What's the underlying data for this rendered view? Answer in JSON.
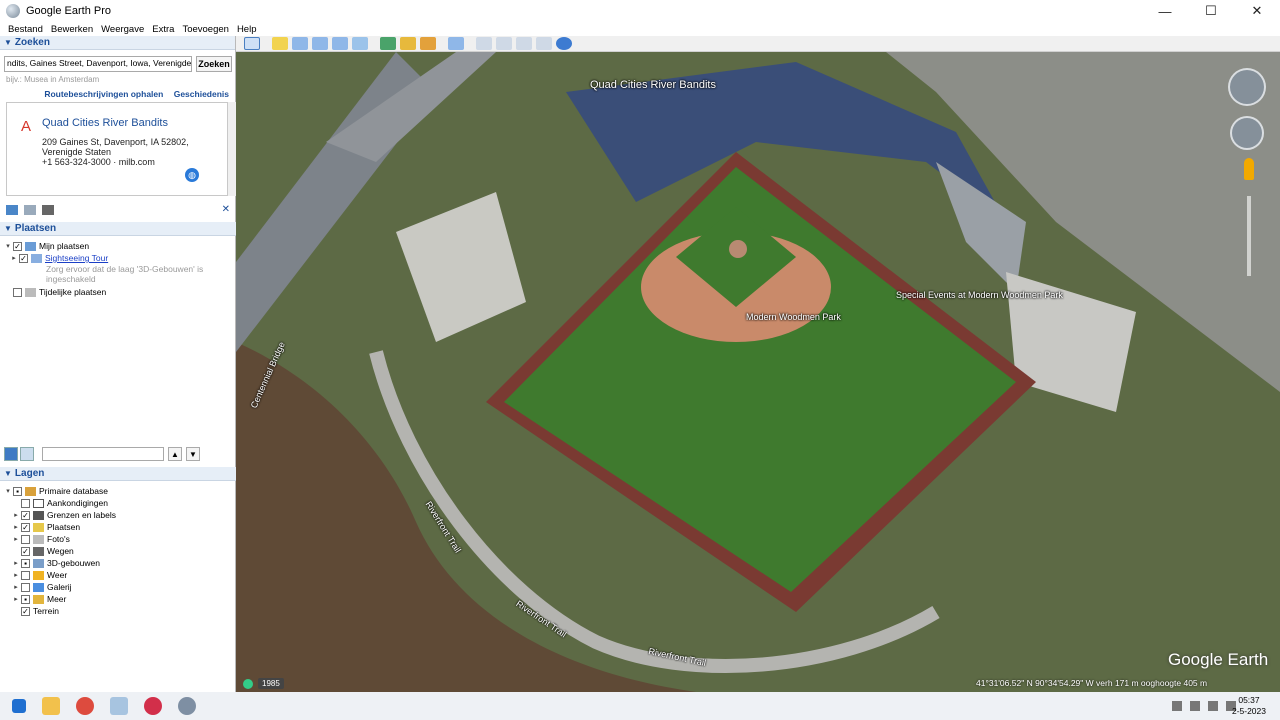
{
  "window": {
    "title": "Google Earth Pro",
    "minimize": "—",
    "maximize": "☐",
    "close": "✕"
  },
  "menu": [
    "Bestand",
    "Bewerken",
    "Weergave",
    "Extra",
    "Toevoegen",
    "Help"
  ],
  "search": {
    "section_title": "Zoeken",
    "query": "ndits, Gaines Street, Davenport, Iowa, Verenigde Staten",
    "button": "Zoeken",
    "hint": "bijv.: Musea in Amsterdam",
    "link_directions": "Routebeschrijvingen ophalen",
    "link_history": "Geschiedenis",
    "result": {
      "marker": "A",
      "title": "Quad Cities River Bandits",
      "line1": "209 Gaines St, Davenport, IA 52802,",
      "line2": "Verenigde Staten",
      "line3": "+1 563-324-3000 · milb.com"
    }
  },
  "places": {
    "section_title": "Plaatsen",
    "my_places": "Mijn plaatsen",
    "sightseeing": "Sightseeing Tour",
    "note1": "Zorg ervoor dat de laag '3D-Gebouwen' is",
    "note2": "ingeschakeld",
    "temp_places": "Tijdelijke plaatsen"
  },
  "layers": {
    "section_title": "Lagen",
    "items": [
      {
        "label": "Primaire database",
        "checked": "▪"
      },
      {
        "label": "Aankondigingen",
        "checked": ""
      },
      {
        "label": "Grenzen en labels",
        "checked": "✓"
      },
      {
        "label": "Plaatsen",
        "checked": "✓"
      },
      {
        "label": "Foto's",
        "checked": ""
      },
      {
        "label": "Wegen",
        "checked": "✓"
      },
      {
        "label": "3D-gebouwen",
        "checked": "▪"
      },
      {
        "label": "Weer",
        "checked": ""
      },
      {
        "label": "Galerij",
        "checked": ""
      },
      {
        "label": "Meer",
        "checked": "▪"
      },
      {
        "label": "Terrein",
        "checked": "✓"
      }
    ]
  },
  "map": {
    "labels": {
      "stadium": "Quad Cities River Bandits",
      "park": "Modern Woodmen Park",
      "events": "Special Events at Modern Woodmen Park",
      "trail1": "Riverfront Trail",
      "trail2": "Riverfront Trail",
      "trail3": "Riverfront Trail",
      "bridge": "Centennial Bridge"
    },
    "year": "1985",
    "watermark": "Google Earth",
    "status": "41°31'06.52\" N    90°34'54.29\" W   verh   171 m        ooghoogte   405 m"
  },
  "taskbar": {
    "time": "05:37",
    "date": "2-5-2023"
  }
}
